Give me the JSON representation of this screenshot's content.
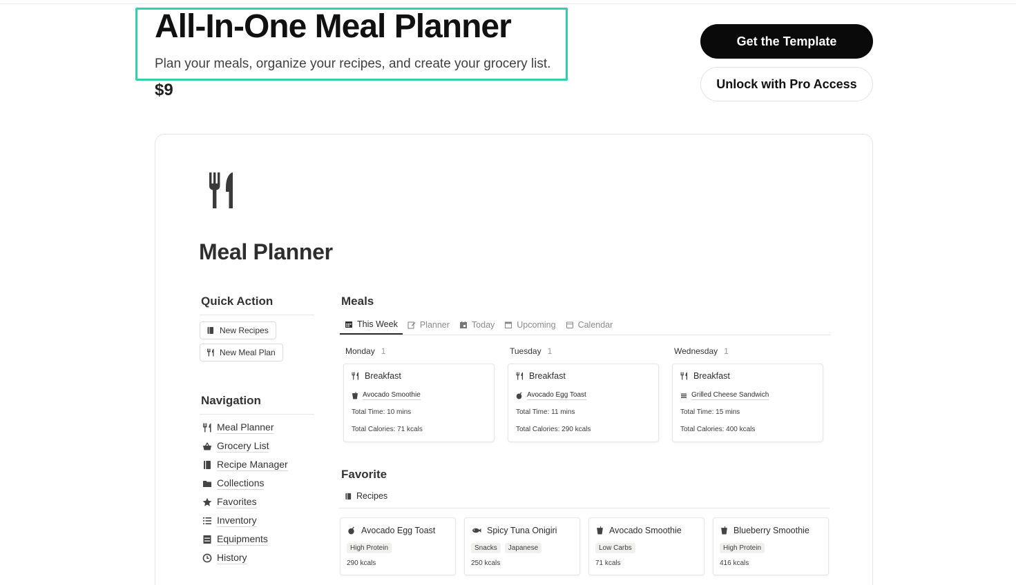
{
  "hero": {
    "title": "All-In-One Meal Planner",
    "subtitle": "Plan your meals, organize your recipes, and create your grocery list.",
    "price": "$9",
    "primary_cta": "Get the Template",
    "secondary_cta": "Unlock with Pro Access"
  },
  "colors": {
    "highlight": "#2fd0b0",
    "primary_button": "#0a0a0a"
  },
  "template": {
    "page_icon": "fork-knife-icon",
    "page_title": "Meal Planner",
    "quick_action": {
      "heading": "Quick Action",
      "buttons": [
        {
          "label": "New Recipes",
          "icon": "book-icon"
        },
        {
          "label": "New Meal Plan",
          "icon": "fork-knife-icon"
        }
      ]
    },
    "navigation": {
      "heading": "Navigation",
      "items": [
        {
          "label": "Meal Planner",
          "icon": "fork-knife-icon"
        },
        {
          "label": "Grocery List",
          "icon": "basket-icon"
        },
        {
          "label": "Recipe Manager",
          "icon": "book-icon"
        },
        {
          "label": "Collections",
          "icon": "folder-icon"
        },
        {
          "label": "Favorites",
          "icon": "star-icon"
        },
        {
          "label": "Inventory",
          "icon": "list-icon"
        },
        {
          "label": "Equipments",
          "icon": "cabinet-icon"
        },
        {
          "label": "History",
          "icon": "clock-icon"
        }
      ]
    },
    "meals": {
      "heading": "Meals",
      "tabs": [
        {
          "label": "This Week",
          "icon": "calendar-grid-icon",
          "active": true
        },
        {
          "label": "Planner",
          "icon": "edit-icon",
          "active": false
        },
        {
          "label": "Today",
          "icon": "calendar-day-icon",
          "active": false
        },
        {
          "label": "Upcoming",
          "icon": "calendar-icon",
          "active": false
        },
        {
          "label": "Calendar",
          "icon": "calendar-outline-icon",
          "active": false
        }
      ],
      "days": [
        {
          "name": "Monday",
          "count": "1",
          "card": {
            "title": "Breakfast",
            "recipe": "Avocado Smoothie",
            "recipe_icon": "cup-icon",
            "time": "Total Time: 10 mins",
            "calories": "Total Calories: 71 kcals"
          }
        },
        {
          "name": "Tuesday",
          "count": "1",
          "card": {
            "title": "Breakfast",
            "recipe": "Avocado Egg Toast",
            "recipe_icon": "avocado-icon",
            "time": "Total Time: 11 mins",
            "calories": "Total Calories: 290 kcals"
          }
        },
        {
          "name": "Wednesday",
          "count": "1",
          "card": {
            "title": "Breakfast",
            "recipe": "Grilled Cheese Sandwich",
            "recipe_icon": "sandwich-icon",
            "time": "Total Time: 15 mins",
            "calories": "Total Calories: 400 kcals"
          }
        }
      ]
    },
    "favorite": {
      "heading": "Favorite",
      "view_label": "Recipes",
      "cards": [
        {
          "title": "Avocado Egg Toast",
          "icon": "avocado-icon",
          "tags": [
            "High Protein"
          ],
          "kcal": "290 kcals"
        },
        {
          "title": "Spicy Tuna Onigiri",
          "icon": "fish-icon",
          "tags": [
            "Snacks",
            "Japanese"
          ],
          "kcal": "250 kcals"
        },
        {
          "title": "Avocado Smoothie",
          "icon": "cup-icon",
          "tags": [
            "Low Carbs"
          ],
          "kcal": "71 kcals"
        },
        {
          "title": "Blueberry Smoothie",
          "icon": "cup-icon",
          "tags": [
            "High Protein"
          ],
          "kcal": "416 kcals"
        }
      ]
    }
  }
}
